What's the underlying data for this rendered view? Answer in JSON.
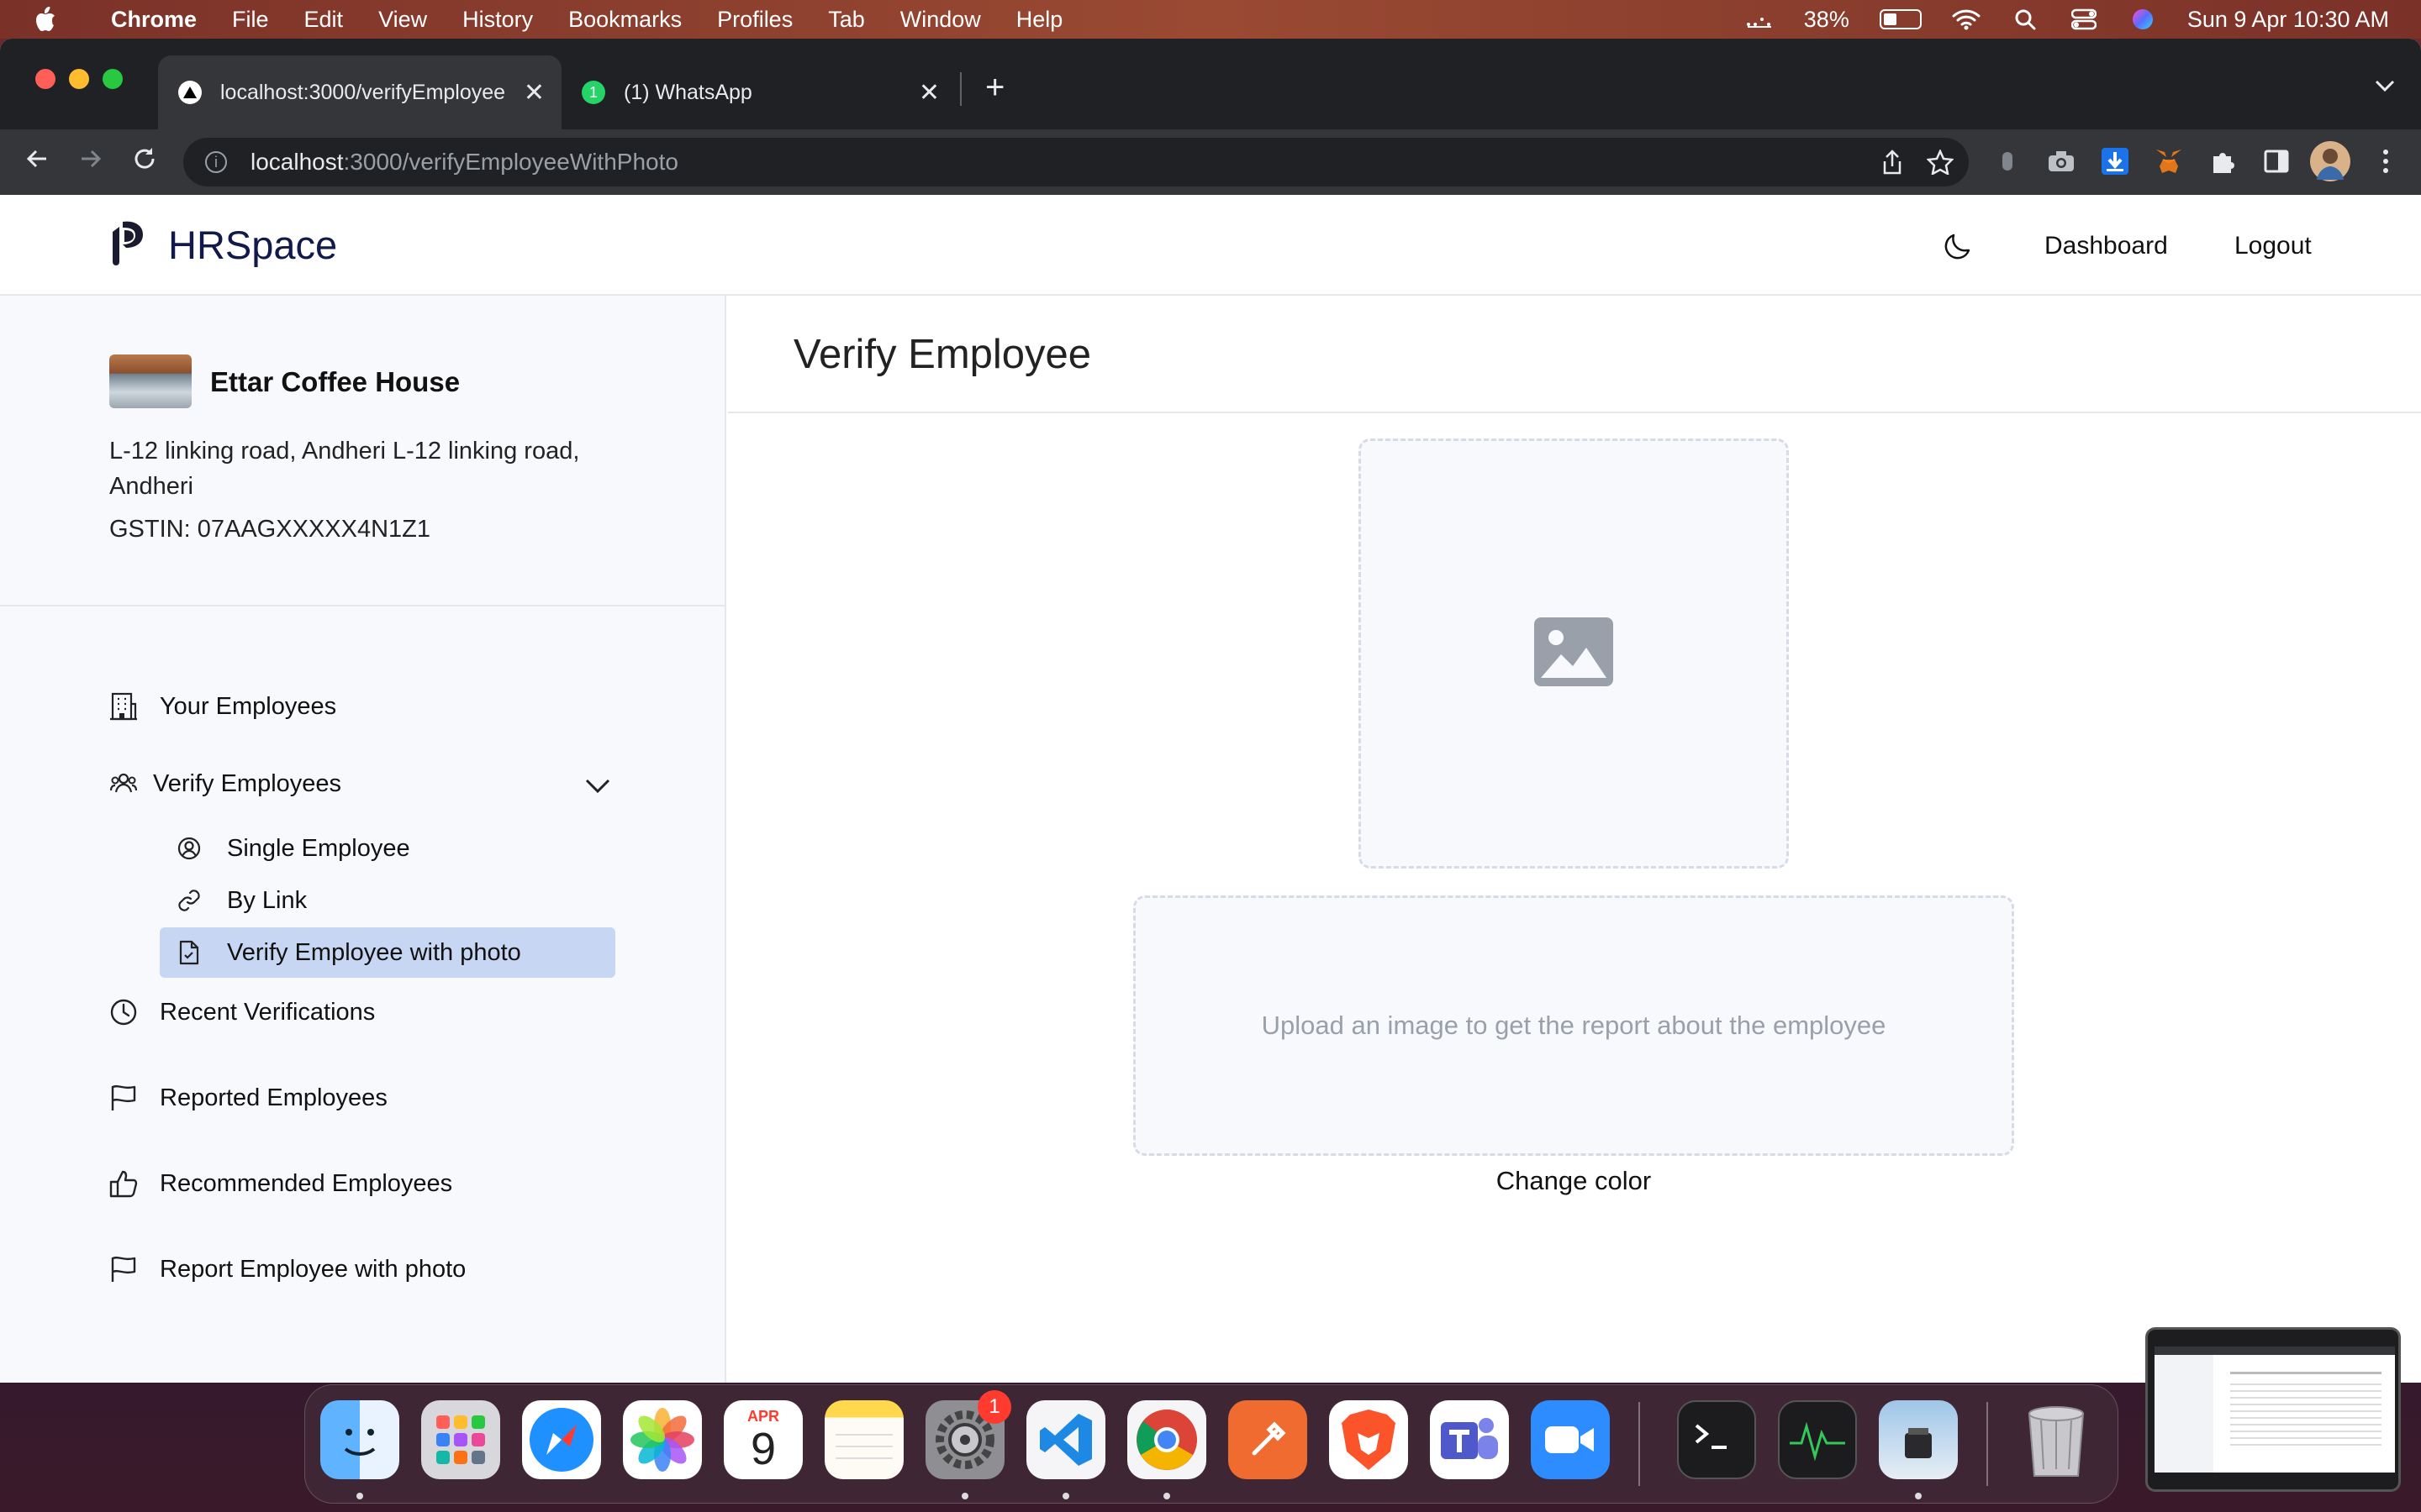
{
  "menubar": {
    "app": "Chrome",
    "items": [
      "File",
      "Edit",
      "View",
      "History",
      "Bookmarks",
      "Profiles",
      "Tab",
      "Window",
      "Help"
    ],
    "battery": "38%",
    "datetime": "Sun 9 Apr  10:30 AM"
  },
  "browser": {
    "tabs": [
      {
        "label": "localhost:3000/verifyEmployee"
      },
      {
        "label": "(1) WhatsApp",
        "badge": "1"
      }
    ],
    "url_host": "localhost",
    "url_rest": ":3000/verifyEmployeeWithPhoto"
  },
  "header": {
    "brand": "HRSpace",
    "links": [
      "Dashboard",
      "Logout"
    ]
  },
  "business": {
    "name": "Ettar Coffee House",
    "address": "L-12 linking road, Andheri L-12 linking road, Andheri",
    "gstin": "GSTIN: 07AAGXXXXX4N1Z1"
  },
  "nav": {
    "your_employees": "Your Employees",
    "verify_employees": "Verify Employees",
    "sub": [
      "Single Employee",
      "By Link",
      "Verify Employee with photo"
    ],
    "recent": "Recent Verifications",
    "reported": "Reported Employees",
    "recommended": "Recommended Employees",
    "report_photo": "Report Employee with photo"
  },
  "main": {
    "title": "Verify Employee",
    "dropzone_text": "Upload an image to get the report about the employee",
    "change_color": "Change color"
  },
  "dock": {
    "calendar_month": "APR",
    "calendar_day": "9",
    "settings_badge": "1"
  },
  "colors": {
    "brand_text": "#111a4a",
    "active_nav": "#c7d6f3",
    "sidebar_bg": "#f8f9fc"
  }
}
